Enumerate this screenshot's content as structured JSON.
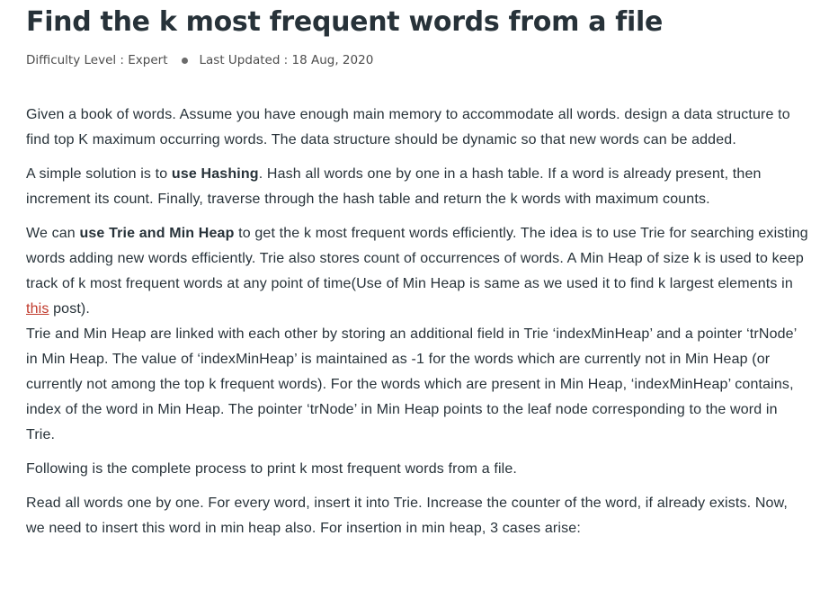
{
  "article": {
    "title": "Find the k most frequent words from a file",
    "difficulty": "Difficulty Level : Expert",
    "updated": "Last Updated : 18 Aug, 2020"
  },
  "content": {
    "p1": "Given a book of words. Assume you have enough main memory to accommodate all words. design a data structure to find top K maximum occurring words. The data structure should be dynamic so that new words can be added.",
    "p2": {
      "before": "A simple solution is to ",
      "bold": "use Hashing",
      "after": ". Hash all words one by one in a hash table. If a word is already present, then increment its count. Finally, traverse through the hash table and return the k words with maximum counts."
    },
    "p3": {
      "before": "We can ",
      "bold": "use Trie and Min Heap",
      "after": " to get the k most frequent words efficiently. The idea is to use Trie for searching existing words adding new words efficiently. Trie also stores count of occurrences of words. A Min Heap of size k is used to keep track of k most frequent words at any point of time(Use of Min Heap is same as we used it to find k largest elements in ",
      "link": "this",
      "end": " post)."
    },
    "p4": "Trie and Min Heap are linked with each other by storing an additional field in Trie ‘indexMinHeap’ and a pointer ‘trNode’ in Min Heap. The value of ‘indexMinHeap’ is maintained as -1 for the words which are currently not in Min Heap (or currently not among the top k frequent words). For the words which are present in Min Heap, ‘indexMinHeap’ contains, index of the word in Min Heap. The pointer ‘trNode’ in Min Heap points to the leaf node corresponding to the word in Trie.",
    "p5": "Following is the complete process to print k most frequent words from a file.",
    "p6": "Read all words one by one. For every word, insert it into Trie. Increase the counter of the word, if already exists. Now, we need to insert this word in min heap also. For insertion in min heap, 3 cases arise:"
  }
}
